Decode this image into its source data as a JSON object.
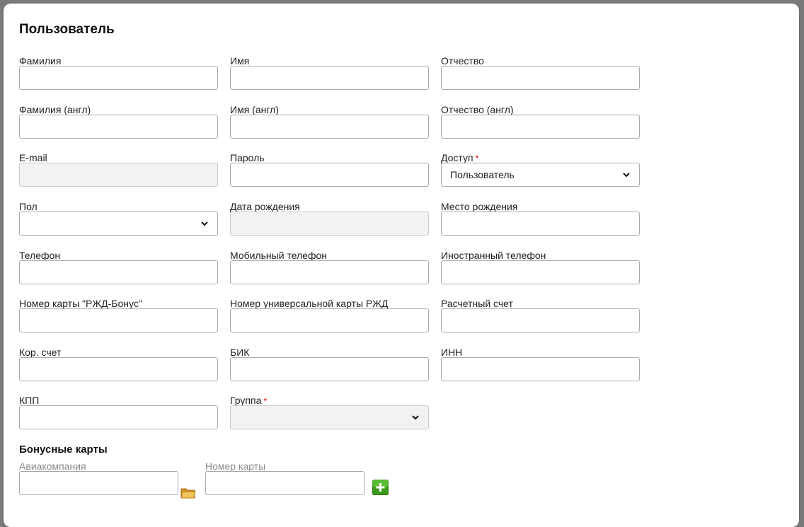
{
  "form": {
    "title": "Пользователь",
    "fields": {
      "last_name": {
        "label": "Фамилия",
        "value": ""
      },
      "first_name": {
        "label": "Имя",
        "value": ""
      },
      "middle_name": {
        "label": "Отчество",
        "value": ""
      },
      "last_name_en": {
        "label": "Фамилия (англ)",
        "value": ""
      },
      "first_name_en": {
        "label": "Имя (англ)",
        "value": ""
      },
      "middle_name_en": {
        "label": "Отчество (англ)",
        "value": ""
      },
      "email": {
        "label": "E-mail",
        "value": ""
      },
      "password": {
        "label": "Пароль",
        "value": ""
      },
      "access": {
        "label": "Доступ",
        "required_mark": "*",
        "value": "Пользователь"
      },
      "gender": {
        "label": "Пол",
        "value": ""
      },
      "birth_date": {
        "label": "Дата рождения",
        "value": ""
      },
      "birth_place": {
        "label": "Место рождения",
        "value": ""
      },
      "phone": {
        "label": "Телефон",
        "value": ""
      },
      "mobile_phone": {
        "label": "Мобильный телефон",
        "value": ""
      },
      "foreign_phone": {
        "label": "Иностранный телефон",
        "value": ""
      },
      "rzd_bonus_card": {
        "label": "Номер карты \"РЖД-Бонус\"",
        "value": ""
      },
      "rzd_universal_card": {
        "label": "Номер универсальной карты РЖД",
        "value": ""
      },
      "settlement_account": {
        "label": "Расчетный счет",
        "value": ""
      },
      "corr_account": {
        "label": "Кор. счет",
        "value": ""
      },
      "bik": {
        "label": "БИК",
        "value": ""
      },
      "inn": {
        "label": "ИНН",
        "value": ""
      },
      "kpp": {
        "label": "КПП",
        "value": ""
      },
      "group": {
        "label": "Группа",
        "required_mark": "*",
        "value": ""
      }
    }
  },
  "bonus_cards": {
    "title": "Бонусные карты",
    "airline_label": "Авиакомпания",
    "airline_value": "",
    "card_number_label": "Номер карты",
    "card_number_value": ""
  },
  "icons": {
    "select_arrow": "chevron-down-icon",
    "folder": "folder-icon",
    "add": "plus-icon"
  },
  "colors": {
    "required": "#dd0000",
    "disabled_bg": "#f2f2f0",
    "add_button": "#3a9a1a",
    "folder": "#e8b03a"
  }
}
